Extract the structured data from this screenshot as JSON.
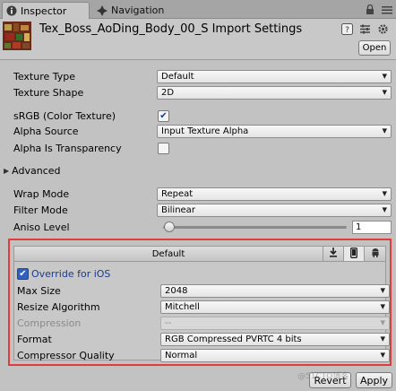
{
  "tabs": [
    {
      "label": "Inspector",
      "icon": "info-icon"
    },
    {
      "label": "Navigation",
      "icon": "navigation-icon"
    }
  ],
  "header": {
    "title": "Tex_Boss_AoDing_Body_00_S Import Settings",
    "open_label": "Open"
  },
  "settings": {
    "texture_type": {
      "label": "Texture Type",
      "value": "Default"
    },
    "texture_shape": {
      "label": "Texture Shape",
      "value": "2D"
    },
    "srgb": {
      "label": "sRGB (Color Texture)",
      "checked": true
    },
    "alpha_source": {
      "label": "Alpha Source",
      "value": "Input Texture Alpha"
    },
    "alpha_transparency": {
      "label": "Alpha Is Transparency",
      "checked": false
    },
    "advanced": {
      "label": "Advanced"
    },
    "wrap_mode": {
      "label": "Wrap Mode",
      "value": "Repeat"
    },
    "filter_mode": {
      "label": "Filter Mode",
      "value": "Bilinear"
    },
    "aniso_level": {
      "label": "Aniso Level",
      "value": "1"
    }
  },
  "platform": {
    "default_tab": "Default",
    "override_label": "Override for iOS",
    "override_checked": true,
    "max_size": {
      "label": "Max Size",
      "value": "2048"
    },
    "resize_algorithm": {
      "label": "Resize Algorithm",
      "value": "Mitchell"
    },
    "compression": {
      "label": "Compression",
      "value": "--"
    },
    "format": {
      "label": "Format",
      "value": "RGB Compressed PVRTC 4 bits"
    },
    "compressor_quality": {
      "label": "Compressor Quality",
      "value": "Normal"
    }
  },
  "footer": {
    "revert_label": "Revert",
    "apply_label": "Apply"
  },
  "watermark": "@51CTO博客",
  "colors": {
    "highlight_border": "#e23b3b",
    "link_blue": "#1a3a8c"
  }
}
